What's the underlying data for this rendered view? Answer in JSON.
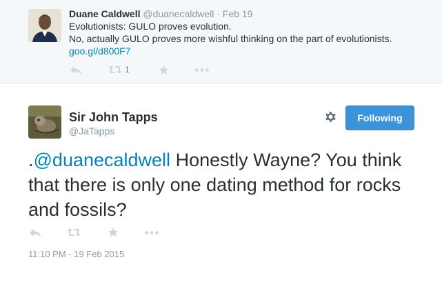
{
  "previous_tweet": {
    "author_name": "Duane Caldwell",
    "author_handle": "@duanecaldwell",
    "separator": "·",
    "date": "Feb 19",
    "lines": [
      "Evolutionists: GULO proves evolution.",
      "No, actually GULO proves more wishful thinking on the part of evolutionists."
    ],
    "link": "goo.gl/d800F7",
    "retweet_count": "1",
    "actions": {
      "reply_icon": "reply-icon",
      "retweet_icon": "retweet-icon",
      "favorite_icon": "star-icon",
      "more_icon": "more-icon"
    }
  },
  "main_tweet": {
    "author_name": "Sir John Tapps",
    "author_handle": "@JaTapps",
    "follow_button_label": "Following",
    "settings_icon": "gear-icon",
    "text_prefix": ".",
    "mention": "@duanecaldwell",
    "text_rest": " Honestly Wayne? You think that there is only one dating method for rocks and fossils?",
    "timestamp": "11:10 PM - 19 Feb 2015"
  },
  "colors": {
    "link": "#0084b4",
    "follow_button": "#3b94d9",
    "muted": "#8899a6",
    "action_icon": "#ccd6dd",
    "card_background": "#f5f8fa"
  }
}
